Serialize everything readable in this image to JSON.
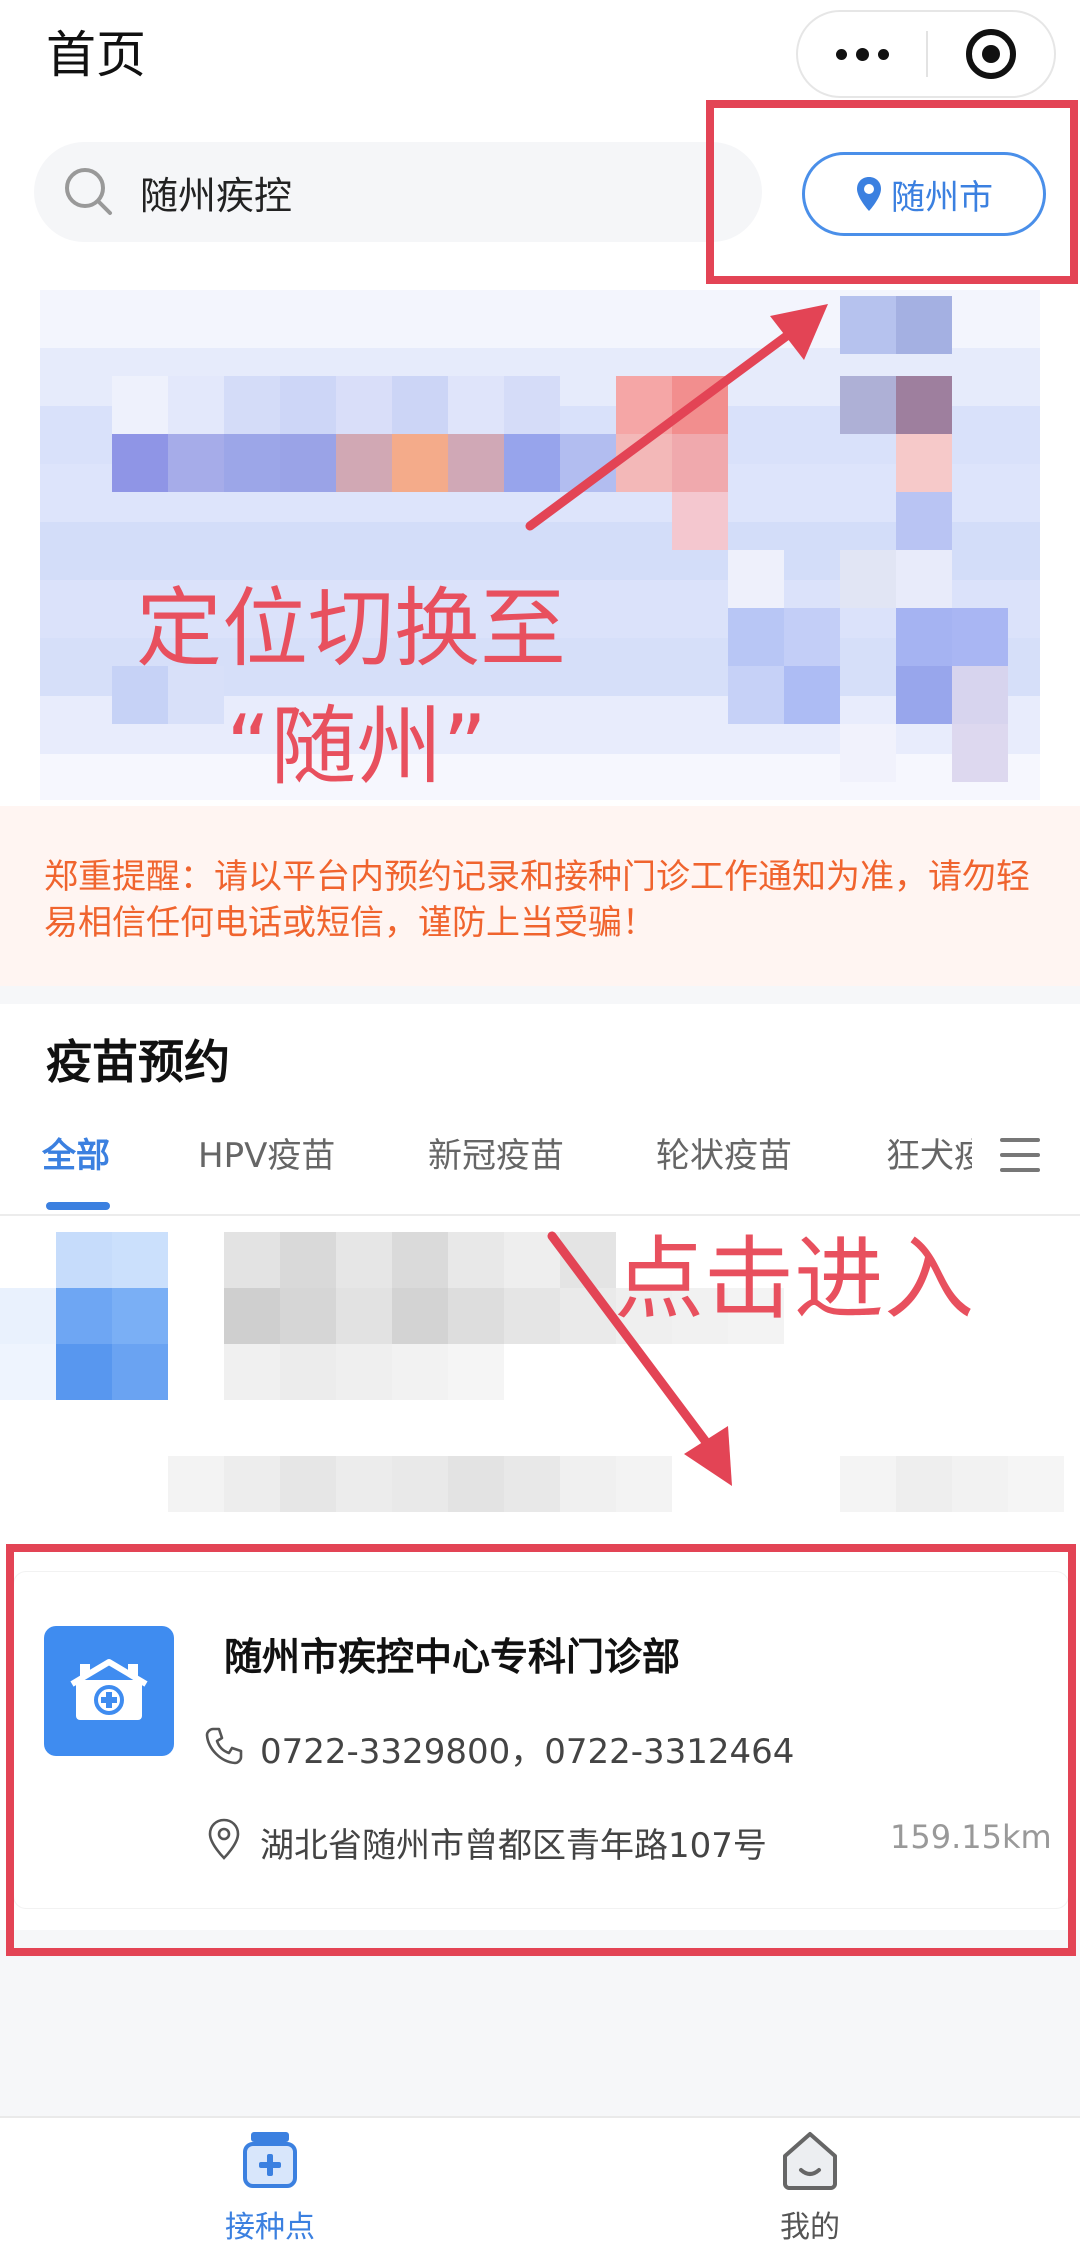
{
  "header": {
    "title": "首页"
  },
  "capsule": {
    "more_icon": "more-dots-icon",
    "close_icon": "target-close-icon"
  },
  "search": {
    "value": "随州疾控",
    "icon": "search-icon"
  },
  "location": {
    "city": "随州市",
    "icon": "location-pin-icon"
  },
  "notice": {
    "text": "郑重提醒：请以平台内预约记录和接种门诊工作通知为准，请勿轻易相信任何电话或短信，谨防上当受骗！"
  },
  "vaccine": {
    "title": "疫苗预约",
    "tabs": [
      {
        "label": "全部",
        "active": true
      },
      {
        "label": "HPV疫苗"
      },
      {
        "label": "新冠疫苗"
      },
      {
        "label": "轮状疫苗"
      },
      {
        "label": "狂犬疫苗"
      }
    ],
    "menu_icon": "hamburger-menu-icon"
  },
  "clinic": {
    "name": "随州市疾控中心专科门诊部",
    "phone": "0722-3329800，0722-3312464",
    "address": "湖北省随州市曾都区青年路107号",
    "distance": "159.15km",
    "logo_icon": "clinic-building-icon"
  },
  "bottom_nav": [
    {
      "label": "接种点",
      "icon": "medicine-box-icon",
      "active": true
    },
    {
      "label": "我的",
      "icon": "home-smile-icon",
      "active": false
    }
  ],
  "annotations": {
    "locate_line1": "定位切换至",
    "locate_line2": "“随州”",
    "click_enter": "点击进入",
    "color": "#e34455"
  },
  "colors": {
    "accent": "#3b80e0",
    "notice": "#f0642e",
    "annotation": "#e34455"
  }
}
